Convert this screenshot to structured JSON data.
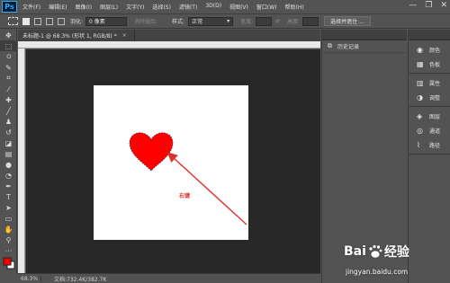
{
  "app": {
    "logo": "Ps"
  },
  "menu": [
    "文件(F)",
    "编辑(E)",
    "图像(I)",
    "图层(L)",
    "文字(Y)",
    "选择(S)",
    "滤镜(T)",
    "3D(D)",
    "视图(V)",
    "窗口(W)",
    "帮助(H)"
  ],
  "window_controls": {
    "minimize": "—",
    "restore": "❐",
    "close": "✕"
  },
  "options_bar": {
    "feather_label": "羽化:",
    "feather_value": "0 像素",
    "antialias": "消除锯齿",
    "style_label": "样式:",
    "style_value": "正常",
    "width_label": "宽度:",
    "height_label": "高度:",
    "select_mask_button": "选择并遮住 ..."
  },
  "document": {
    "tab_title": "未标题-1 @ 68.3% (形状 1, RGB/8) *",
    "tab_close": "×",
    "annotation_label": "右键"
  },
  "status_bar": {
    "zoom": "68.3%",
    "doc_info": "文档:732.4K/382.7K"
  },
  "history_panel": {
    "label": "历史记录",
    "icon": "history-icon"
  },
  "right_panels": [
    {
      "icon": "palette-icon",
      "label": "颜色"
    },
    {
      "icon": "swatches-icon",
      "label": "色板"
    },
    {
      "icon": "properties-icon",
      "label": "属性"
    },
    {
      "icon": "adjustments-icon",
      "label": "调整"
    },
    {
      "icon": "layers-icon",
      "label": "图层"
    },
    {
      "icon": "channels-icon",
      "label": "通道"
    },
    {
      "icon": "paths-icon",
      "label": "路径"
    }
  ],
  "colors": {
    "heart": "#ff0000",
    "arrow": "#e0302a",
    "workspace": "#282828",
    "ui_background": "#535353"
  },
  "watermark": {
    "brand_pre": "Bai",
    "brand_post": "经验",
    "url": "jingyan.baidu.com"
  }
}
